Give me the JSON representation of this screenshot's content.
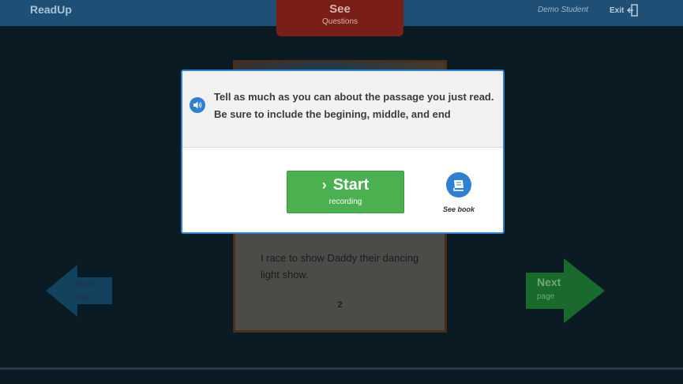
{
  "header": {
    "brand": "ReadUp",
    "user_name": "Demo Student",
    "exit_label": "Exit"
  },
  "questions_tab": {
    "title": "See",
    "subtitle": "Questions"
  },
  "book": {
    "page_text": "I race to show Daddy their dancing light show.",
    "page_number": "2"
  },
  "navigation": {
    "back_label": "Back",
    "back_sub": "page",
    "next_label": "Next",
    "next_sub": "page"
  },
  "modal": {
    "prompt": "Tell as much as you can about the passage you just read. Be sure to include the begining, middle, and end",
    "start_label": "Start",
    "start_sub": "recording",
    "see_book_label": "See book"
  },
  "colors": {
    "accent_blue": "#2f7fd2",
    "start_green": "#4bb04f",
    "tab_red": "#7a1e18"
  }
}
